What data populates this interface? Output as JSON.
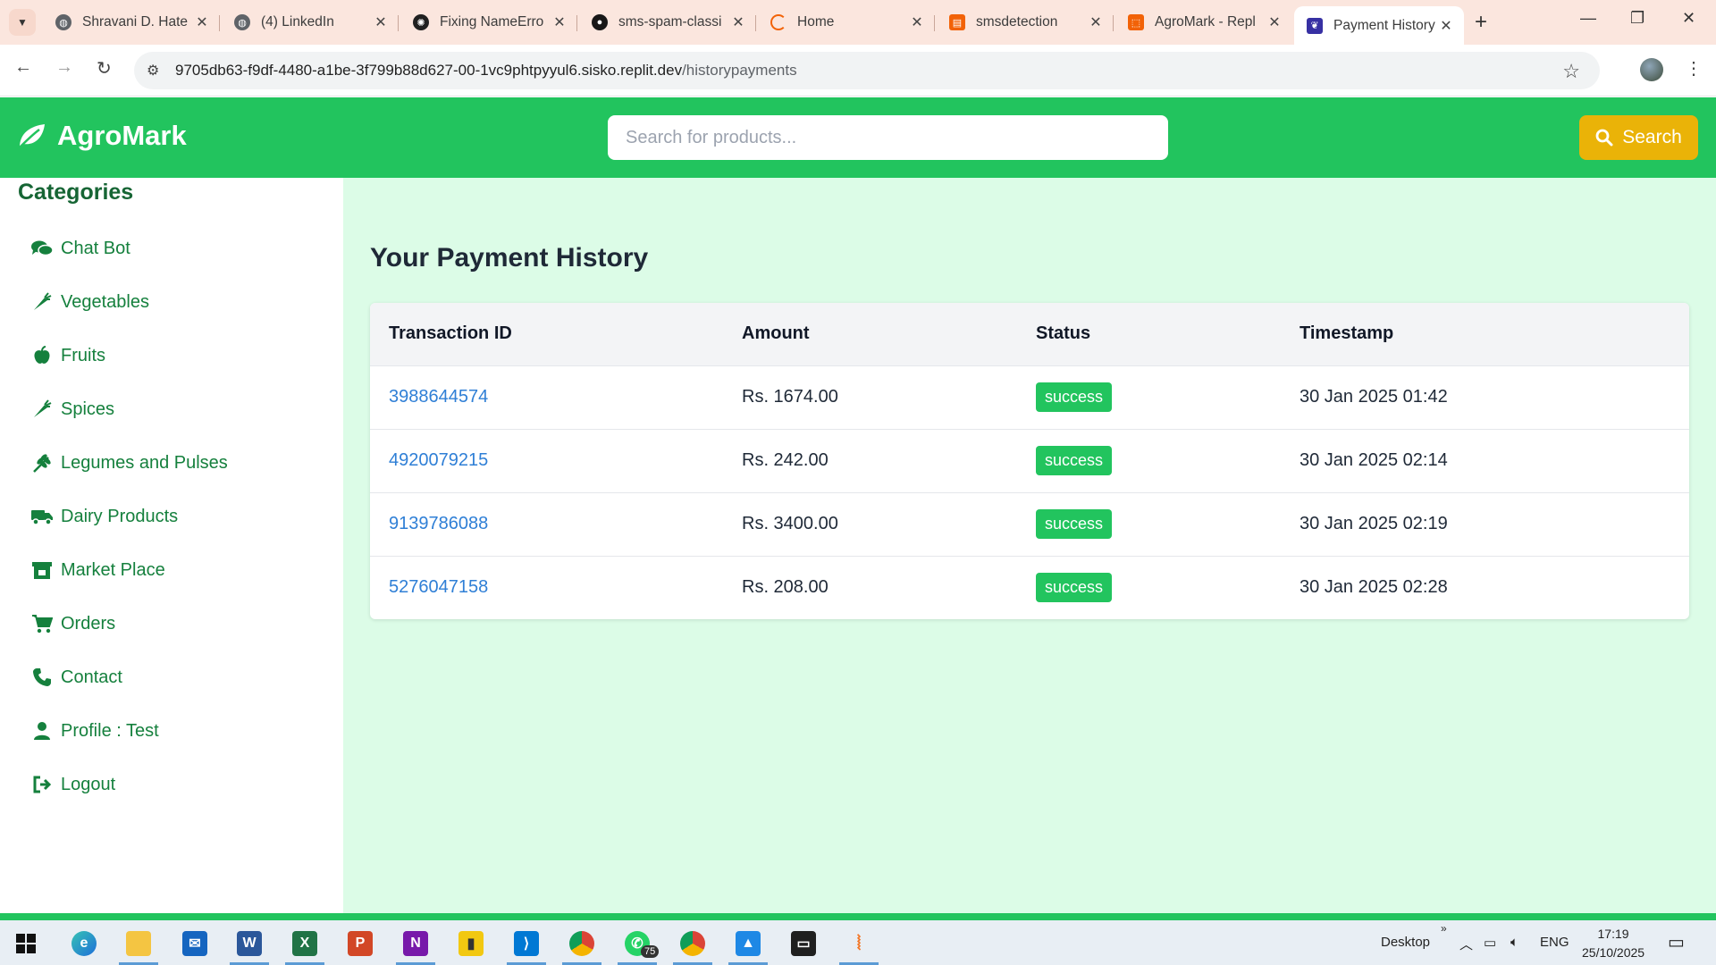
{
  "browser": {
    "tabs": [
      {
        "title": "Shravani D. Hate",
        "icon": "globe-icon",
        "color": "#5f6368"
      },
      {
        "title": "(4) LinkedIn",
        "icon": "globe-icon",
        "color": "#5f6368"
      },
      {
        "title": "Fixing NameErro",
        "icon": "openai-icon",
        "color": "#202020"
      },
      {
        "title": "sms-spam-classi",
        "icon": "github-icon",
        "color": "#181717"
      },
      {
        "title": "Home",
        "icon": "loading-icon",
        "color": "#f26207"
      },
      {
        "title": "smsdetection",
        "icon": "notebook-icon",
        "color": "#f26207"
      },
      {
        "title": "AgroMark - Repl",
        "icon": "replit-icon",
        "color": "#f26207"
      },
      {
        "title": "Payment History",
        "icon": "leaf-page-icon",
        "color": "#3730a3",
        "active": true
      }
    ],
    "url_host": "9705db63-f9df-4480-a1be-3f799b88d627-00-1vc9phtpyyul6.sisko.replit.dev",
    "url_path": "/historypayments"
  },
  "header": {
    "brand": "AgroMark",
    "search_placeholder": "Search for products...",
    "search_button": "Search",
    "brand_color": "#22c45e",
    "button_color": "#eab308"
  },
  "sidebar": {
    "title": "Categories",
    "items": [
      {
        "label": "Chat Bot",
        "icon": "comments-icon"
      },
      {
        "label": "Vegetables",
        "icon": "carrot-icon"
      },
      {
        "label": "Fruits",
        "icon": "apple-icon"
      },
      {
        "label": "Spices",
        "icon": "pepper-icon"
      },
      {
        "label": "Legumes and Pulses",
        "icon": "wheat-icon"
      },
      {
        "label": "Dairy Products",
        "icon": "truck-icon"
      },
      {
        "label": "Market Place",
        "icon": "store-icon"
      },
      {
        "label": "Orders",
        "icon": "cart-icon"
      },
      {
        "label": "Contact",
        "icon": "phone-icon"
      },
      {
        "label": "Profile : Test",
        "icon": "user-icon"
      },
      {
        "label": "Logout",
        "icon": "logout-icon"
      }
    ]
  },
  "main": {
    "title": "Your Payment History",
    "columns": [
      "Transaction ID",
      "Amount",
      "Status",
      "Timestamp"
    ],
    "rows": [
      {
        "txn": "3988644574",
        "amount": "Rs. 1674.00",
        "status": "success",
        "time": "30 Jan 2025 01:42"
      },
      {
        "txn": "4920079215",
        "amount": "Rs. 242.00",
        "status": "success",
        "time": "30 Jan 2025 02:14"
      },
      {
        "txn": "9139786088",
        "amount": "Rs. 3400.00",
        "status": "success",
        "time": "30 Jan 2025 02:19"
      },
      {
        "txn": "5276047158",
        "amount": "Rs. 208.00",
        "status": "success",
        "time": "30 Jan 2025 02:28"
      }
    ]
  },
  "taskbar": {
    "desktop_label": "Desktop",
    "language": "ENG",
    "time": "17:19",
    "date": "25/10/2025",
    "whatsapp_badge": "75"
  }
}
